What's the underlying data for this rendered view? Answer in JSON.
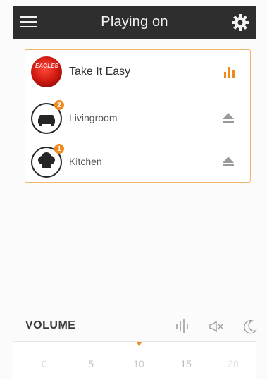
{
  "header": {
    "title": "Playing on",
    "menu_icon": "menu-icon",
    "settings_icon": "gear-icon"
  },
  "now_playing": {
    "track_title": "Take It Easy",
    "art_text": "EAGLES",
    "status_icon": "equalizer-bars-icon",
    "accent": "#f08a1c"
  },
  "rooms": [
    {
      "name": "Livingroom",
      "badge": "2",
      "icon": "sofa-icon",
      "action_icon": "eject-icon"
    },
    {
      "name": "Kitchen",
      "badge": "1",
      "icon": "chef-hat-icon",
      "action_icon": "eject-icon"
    }
  ],
  "volume": {
    "label": "VOLUME",
    "current": 10,
    "ticks": [
      "0",
      "5",
      "10",
      "15",
      "20"
    ],
    "icons": [
      "equalizer-icon",
      "mute-icon",
      "sleep-timer-icon"
    ]
  }
}
